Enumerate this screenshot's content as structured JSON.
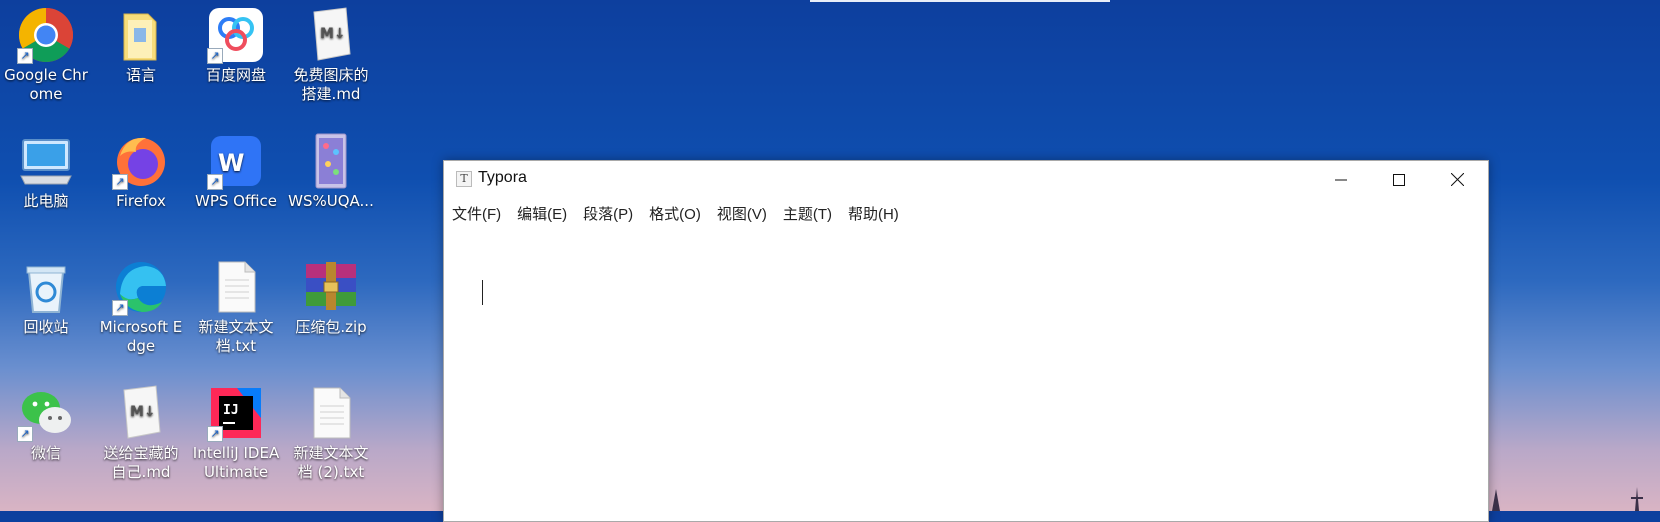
{
  "desktop": {
    "icons": [
      {
        "label": "Google Chrome",
        "icon": "chrome-icon"
      },
      {
        "label": "语言",
        "icon": "folder-icon"
      },
      {
        "label": "百度网盘",
        "icon": "baidu-netdisk-icon"
      },
      {
        "label": "免费图床的搭建.md",
        "icon": "markdown-file-icon"
      },
      {
        "label": "此电脑",
        "icon": "computer-icon"
      },
      {
        "label": "Firefox",
        "icon": "firefox-icon"
      },
      {
        "label": "WPS Office",
        "icon": "wps-office-icon"
      },
      {
        "label": "WS%UQA...",
        "icon": "image-file-icon"
      },
      {
        "label": "回收站",
        "icon": "recycle-bin-icon"
      },
      {
        "label": "Microsoft Edge",
        "icon": "edge-icon"
      },
      {
        "label": "新建文本文档.txt",
        "icon": "text-file-icon"
      },
      {
        "label": "压缩包.zip",
        "icon": "zip-archive-icon"
      },
      {
        "label": "微信",
        "icon": "wechat-icon"
      },
      {
        "label": "送给宝藏的自己.md",
        "icon": "markdown-file-icon"
      },
      {
        "label": "IntelliJ IDEA Ultimate",
        "icon": "intellij-idea-icon"
      },
      {
        "label": "新建文本文档 (2).txt",
        "icon": "text-file-icon"
      }
    ]
  },
  "window": {
    "app_icon_letter": "T",
    "title": "Typora",
    "menu": [
      "文件(F)",
      "编辑(E)",
      "段落(P)",
      "格式(O)",
      "视图(V)",
      "主题(T)",
      "帮助(H)"
    ]
  },
  "colors": {
    "desktop_top": "#0d3f9e",
    "desktop_bottom": "#d9b4c4",
    "window_bg": "#ffffff",
    "close_hover": "#e81123"
  }
}
